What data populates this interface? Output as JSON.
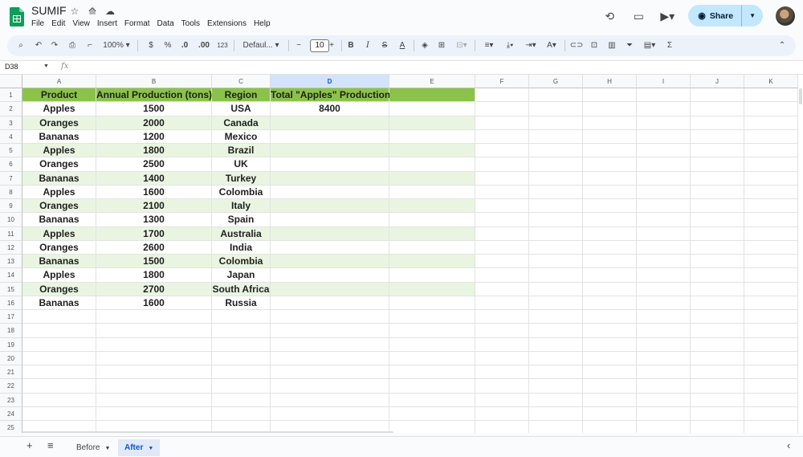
{
  "app": {
    "title": "SUMIF",
    "menu": [
      "File",
      "Edit",
      "View",
      "Insert",
      "Format",
      "Data",
      "Tools",
      "Extensions",
      "Help"
    ],
    "share_label": "Share",
    "accent_color": "#0b57d0",
    "header_fill_color": "#8bc34a",
    "band_color": "#e9f5e1"
  },
  "toolbar": {
    "zoom": "100%",
    "currency": "$",
    "percent": "%",
    "decrease_decimal": ".0",
    "increase_decimal": ".00",
    "number_format": "123",
    "font": "Defaul...",
    "font_size": "10"
  },
  "formula_bar": {
    "cell_ref": "D38",
    "fx": "fx",
    "value": ""
  },
  "grid": {
    "columns": [
      "A",
      "B",
      "C",
      "D",
      "E",
      "F",
      "G",
      "H",
      "I",
      "J",
      "K"
    ],
    "selected_column": "D",
    "row_count": 27,
    "header_row": [
      "Product",
      "Annual Production (tons)",
      "Region",
      "Total \"Apples\" Production",
      ""
    ],
    "rows": [
      [
        "Apples",
        "1500",
        "USA",
        "8400"
      ],
      [
        "Oranges",
        "2000",
        "Canada",
        ""
      ],
      [
        "Bananas",
        "1200",
        "Mexico",
        ""
      ],
      [
        "Apples",
        "1800",
        "Brazil",
        ""
      ],
      [
        "Oranges",
        "2500",
        "UK",
        ""
      ],
      [
        "Bananas",
        "1400",
        "Turkey",
        ""
      ],
      [
        "Apples",
        "1600",
        "Colombia",
        ""
      ],
      [
        "Oranges",
        "2100",
        "Italy",
        ""
      ],
      [
        "Bananas",
        "1300",
        "Spain",
        ""
      ],
      [
        "Apples",
        "1700",
        "Australia",
        ""
      ],
      [
        "Oranges",
        "2600",
        "India",
        ""
      ],
      [
        "Bananas",
        "1500",
        "Colombia",
        ""
      ],
      [
        "Apples",
        "1800",
        "Japan",
        ""
      ],
      [
        "Oranges",
        "2700",
        "South Africa",
        ""
      ],
      [
        "Bananas",
        "1600",
        "Russia",
        ""
      ]
    ]
  },
  "sheets": {
    "tabs": [
      "Before",
      "After"
    ],
    "active": "After"
  }
}
